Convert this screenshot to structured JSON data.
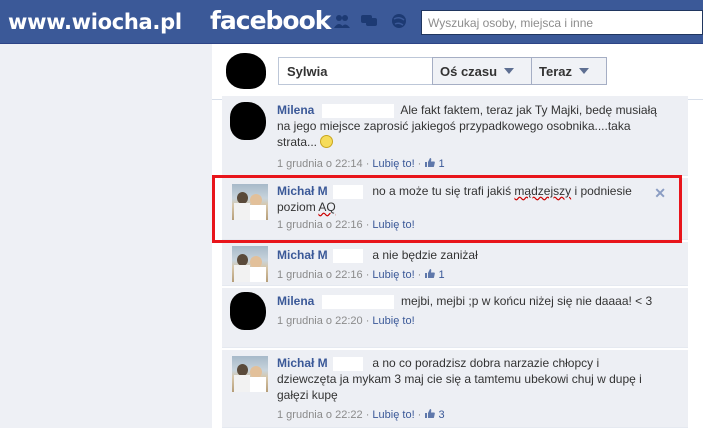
{
  "watermark": "www.wiocha.pl",
  "topbar": {
    "logo": "facebook",
    "search_placeholder": "Wyszukaj osoby, miejsca i inne",
    "icons": [
      "friend-requests-icon",
      "messages-icon",
      "notifications-icon"
    ]
  },
  "header": {
    "name": "Sylwia",
    "timeline_button": "Oś czasu",
    "now_button": "Teraz"
  },
  "comments": [
    {
      "author": "Milena",
      "text": "Ale fakt faktem, teraz jak Ty Majki, bedę musiałą na jego miejsce zaprosić jakiegoś przypadkowego osobnika....taka strata...",
      "date": "1 grudnia o 22:14",
      "like_label": "Lubię to!",
      "likes": "1"
    },
    {
      "author": "Michał M",
      "text_before": "no a może tu się trafi jakiś ",
      "text_underlined": "mądzejszy",
      "text_middle": " i podniesie poziom ",
      "text_underlined2": "AQ",
      "date": "1 grudnia o 22:16",
      "like_label": "Lubię to!",
      "likes": ""
    },
    {
      "author": "Michał M",
      "text": "a nie będzie zaniżał",
      "date": "1 grudnia o 22:16",
      "like_label": "Lubię to!",
      "likes": "1"
    },
    {
      "author": "Milena",
      "text": "mejbi, mejbi ;p w końcu niżej się nie daaaa! < 3",
      "date": "1 grudnia o 22:20",
      "like_label": "Lubię to!",
      "likes": ""
    },
    {
      "author": "Michał M",
      "text": "a no co poradzisz dobra narzazie chłopcy i dziewczęta ja mykam 3 maj cie się a tamtemu ubekowi chuj w dupę i gałęzi kupę",
      "date": "1 grudnia o 22:22",
      "like_label": "Lubię to!",
      "likes": "3"
    }
  ],
  "colors": {
    "fb_blue": "#3b5998",
    "highlight_red": "#e8151b",
    "comment_bg": "#edeff4"
  }
}
